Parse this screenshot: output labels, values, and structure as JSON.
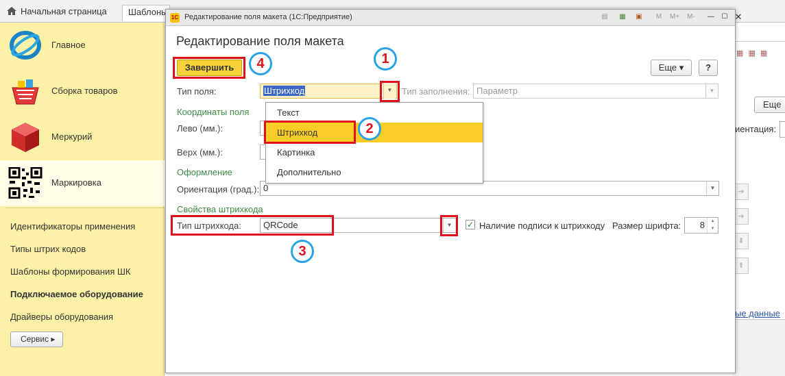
{
  "tabs": {
    "home": "Начальная страница",
    "templates": "Шаблоны"
  },
  "sidebar": {
    "sections": [
      {
        "label": "Главное",
        "icon": "globe-icon"
      },
      {
        "label": "Сборка товаров",
        "icon": "basket-icon"
      },
      {
        "label": "Меркурий",
        "icon": "cube-icon"
      },
      {
        "label": "Маркировка",
        "icon": "qr-code-icon"
      }
    ],
    "links": [
      "Идентификаторы применения",
      "Типы штрих кодов",
      "Шаблоны формирования ШК",
      "Подключаемое оборудование",
      "Драйверы оборудования"
    ],
    "service_button": "Сервис ▸"
  },
  "background": {
    "more_button": "Еще",
    "orientation_label": "иентация:",
    "link": "ые данные"
  },
  "window": {
    "title": "Редактирование поля макета  (1С:Предприятие)",
    "heading": "Редактирование поля макета",
    "toolbar_icons": [
      "print-icon",
      "calculator-icon",
      "calendar-icon",
      "M",
      "M+",
      "M-",
      "minimize-icon",
      "maximize-icon",
      "close-icon"
    ]
  },
  "form": {
    "finish_button": "Завершить",
    "more_button": "Еще ▾",
    "help_button": "?",
    "field_type_label": "Тип поля:",
    "field_type_value": "Штрихкод",
    "fill_type_label": "Тип заполнения:",
    "fill_type_value": "Параметр",
    "coords_section": "Координаты поля",
    "left_label": "Лево (мм.):",
    "top_label": "Верх (мм.):",
    "design_section": "Оформление",
    "orientation_label": "Ориентация (град.):",
    "orientation_value": "0",
    "barcode_section": "Свойства штрихкода",
    "barcode_type_label": "Тип штрихкода:",
    "barcode_type_value": "QRCode",
    "caption_checkbox_label": "Наличие подписи к штрихкоду",
    "caption_checked": true,
    "font_size_label": "Размер шрифта:",
    "font_size_value": "8"
  },
  "dropdown": {
    "options": [
      "Текст",
      "Штрихкод",
      "Картинка",
      "Дополнительно"
    ],
    "selected": "Штрихкод"
  },
  "annotations": [
    "1",
    "2",
    "3",
    "4"
  ],
  "colors": {
    "accent": "#f9cd25",
    "section": "#3c8c44",
    "annotation_red": "#e0101a",
    "annotation_blue": "#2aa3e6",
    "sidebar": "#fbf1a7"
  }
}
